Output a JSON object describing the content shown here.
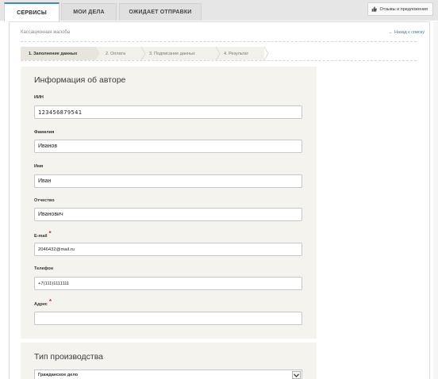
{
  "tabs": [
    {
      "label": "СЕРВИСЫ"
    },
    {
      "label": "МОИ ДЕЛА"
    },
    {
      "label": "ОЖИДАЕТ ОТПРАВКИ"
    }
  ],
  "feedback_button": {
    "label": "Отзывы и предложения",
    "icon": "thumbs-up-icon"
  },
  "header": {
    "subtitle": "Кассационная жалоба",
    "back_link": "← Назад к списку"
  },
  "steps": [
    {
      "label": "1. Заполнение данных",
      "active": true
    },
    {
      "label": "2. Оплата",
      "active": false
    },
    {
      "label": "3. Подписание данных",
      "active": false
    },
    {
      "label": "4. Результат",
      "active": false
    }
  ],
  "author_section": {
    "title": "Информация об авторе",
    "fields": {
      "iin": {
        "label": "ИИН",
        "value": "123456879541"
      },
      "last_name": {
        "label": "Фамилия",
        "value": "Иванов"
      },
      "first_name": {
        "label": "Имя",
        "value": "Иван"
      },
      "patronymic": {
        "label": "Отчество",
        "value": "Иванович"
      },
      "email": {
        "label": "E-mail",
        "required_mark": "*",
        "value": "2046432@mail.ru"
      },
      "phone": {
        "label": "Телефон",
        "value": "+7(111)1111111"
      },
      "address": {
        "label": "Адрес",
        "required_mark": "*",
        "value": ""
      }
    }
  },
  "production_section": {
    "title": "Тип производства",
    "selected": "Гражданское дело"
  },
  "colors": {
    "accent": "#3c8bc7",
    "card_bg": "#f5f3ee",
    "required": "#c0392b",
    "link": "#2a7bbf"
  }
}
